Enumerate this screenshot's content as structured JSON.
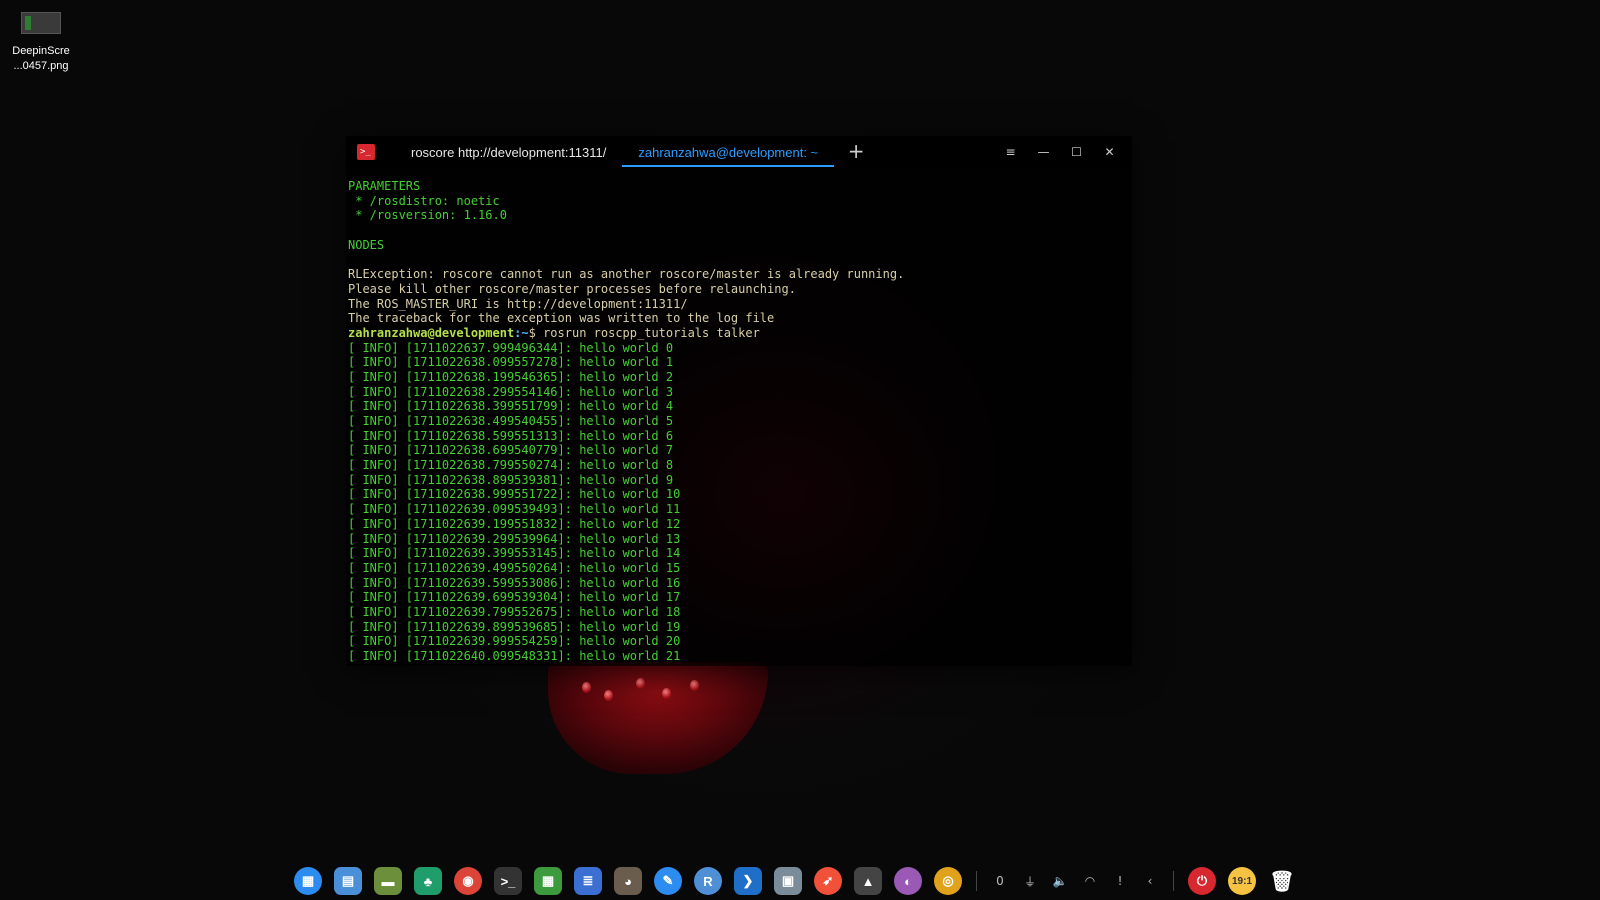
{
  "desktop": {
    "file_icon": {
      "label_line1": "DeepinScre",
      "label_line2": "...0457.png"
    }
  },
  "terminal": {
    "tabs": [
      {
        "label": "roscore http://development:11311/",
        "active": false
      },
      {
        "label": "zahranzahwa@development: ~",
        "active": true
      }
    ],
    "add_tab": "+",
    "controls": {
      "menu": "≡",
      "minimize": "—",
      "maximize": "☐",
      "close": "✕"
    },
    "lines": [
      {
        "text": "PARAMETERS",
        "style": "green"
      },
      {
        "text": " * /rosdistro: noetic",
        "style": "green"
      },
      {
        "text": " * /rosversion: 1.16.0",
        "style": "green"
      },
      {
        "text": "",
        "style": "text"
      },
      {
        "text": "NODES",
        "style": "green"
      },
      {
        "text": "",
        "style": "text"
      },
      {
        "text": "RLException: roscore cannot run as another roscore/master is already running.",
        "style": "text"
      },
      {
        "text": "Please kill other roscore/master processes before relaunching.",
        "style": "text"
      },
      {
        "text": "The ROS_MASTER_URI is http://development:11311/",
        "style": "text"
      },
      {
        "text": "The traceback for the exception was written to the log file",
        "style": "text"
      },
      {
        "style": "prompt",
        "user": "zahranzahwa@development",
        "path": ":~",
        "cmd": "$ rosrun roscpp_tutorials talker"
      },
      {
        "text": "[ INFO] [1711022637.999496344]: hello world 0",
        "style": "green"
      },
      {
        "text": "[ INFO] [1711022638.099557278]: hello world 1",
        "style": "green"
      },
      {
        "text": "[ INFO] [1711022638.199546365]: hello world 2",
        "style": "green"
      },
      {
        "text": "[ INFO] [1711022638.299554146]: hello world 3",
        "style": "green"
      },
      {
        "text": "[ INFO] [1711022638.399551799]: hello world 4",
        "style": "green"
      },
      {
        "text": "[ INFO] [1711022638.499540455]: hello world 5",
        "style": "green"
      },
      {
        "text": "[ INFO] [1711022638.599551313]: hello world 6",
        "style": "green"
      },
      {
        "text": "[ INFO] [1711022638.699540779]: hello world 7",
        "style": "green"
      },
      {
        "text": "[ INFO] [1711022638.799550274]: hello world 8",
        "style": "green"
      },
      {
        "text": "[ INFO] [1711022638.899539381]: hello world 9",
        "style": "green"
      },
      {
        "text": "[ INFO] [1711022638.999551722]: hello world 10",
        "style": "green"
      },
      {
        "text": "[ INFO] [1711022639.099539493]: hello world 11",
        "style": "green"
      },
      {
        "text": "[ INFO] [1711022639.199551832]: hello world 12",
        "style": "green"
      },
      {
        "text": "[ INFO] [1711022639.299539964]: hello world 13",
        "style": "green"
      },
      {
        "text": "[ INFO] [1711022639.399553145]: hello world 14",
        "style": "green"
      },
      {
        "text": "[ INFO] [1711022639.499550264]: hello world 15",
        "style": "green"
      },
      {
        "text": "[ INFO] [1711022639.599553086]: hello world 16",
        "style": "green"
      },
      {
        "text": "[ INFO] [1711022639.699539304]: hello world 17",
        "style": "green"
      },
      {
        "text": "[ INFO] [1711022639.799552675]: hello world 18",
        "style": "green"
      },
      {
        "text": "[ INFO] [1711022639.899539685]: hello world 19",
        "style": "green"
      },
      {
        "text": "[ INFO] [1711022639.999554259]: hello world 20",
        "style": "green"
      },
      {
        "text": "[ INFO] [1711022640.099548331]: hello world 21",
        "style": "green"
      }
    ]
  },
  "dock": {
    "apps": [
      {
        "name": "launcher-icon",
        "glyph": "▦",
        "color": "#2d8cf0",
        "round": true
      },
      {
        "name": "multitasking-icon",
        "glyph": "▤",
        "color": "#4a90d9"
      },
      {
        "name": "file-manager-icon",
        "glyph": "▬",
        "color": "#6b8f3a"
      },
      {
        "name": "app-store-icon",
        "glyph": "♣",
        "color": "#1f9d6b"
      },
      {
        "name": "chrome-icon",
        "glyph": "◉",
        "color": "#db4437",
        "round": true
      },
      {
        "name": "terminal-icon",
        "glyph": ">_",
        "color": "#333333"
      },
      {
        "name": "spreadsheet-icon",
        "glyph": "▦",
        "color": "#3c9b3c"
      },
      {
        "name": "document-icon",
        "glyph": "≣",
        "color": "#3b6fd1"
      },
      {
        "name": "gimp-icon",
        "glyph": "◕",
        "color": "#6a5d4d"
      },
      {
        "name": "draw-icon",
        "glyph": "✎",
        "color": "#2d8cf0",
        "round": true
      },
      {
        "name": "r-studio-icon",
        "glyph": "R",
        "color": "#4f8fd6",
        "round": true
      },
      {
        "name": "vscode-icon",
        "glyph": "❯",
        "color": "#1f6fc8"
      },
      {
        "name": "archive-manager-icon",
        "glyph": "▣",
        "color": "#7a8b99"
      },
      {
        "name": "swift-icon",
        "glyph": "➶",
        "color": "#f05138",
        "round": true
      },
      {
        "name": "inkscape-icon",
        "glyph": "▲",
        "color": "#444444"
      },
      {
        "name": "color-picker-icon",
        "glyph": "◐",
        "color": "#9b59b6",
        "round": true
      },
      {
        "name": "blender-icon",
        "glyph": "◎",
        "color": "#e0a21a",
        "round": true
      }
    ],
    "tray": [
      {
        "name": "notification-count-icon",
        "glyph": "0"
      },
      {
        "name": "usb-icon",
        "glyph": "⏚"
      },
      {
        "name": "volume-icon",
        "glyph": "🔈"
      },
      {
        "name": "wifi-icon",
        "glyph": "◠"
      },
      {
        "name": "alert-icon",
        "glyph": "!"
      },
      {
        "name": "chevron-left-icon",
        "glyph": "‹"
      }
    ],
    "power_glyph": "⏻",
    "clock": "19:1",
    "trash_glyph": "🗑"
  },
  "colors": {
    "accent": "#2d9cff",
    "terminal_green": "#44d032",
    "terminal_text": "#d8cfa8",
    "power": "#d7282f",
    "clock_bg": "#f5c242"
  }
}
